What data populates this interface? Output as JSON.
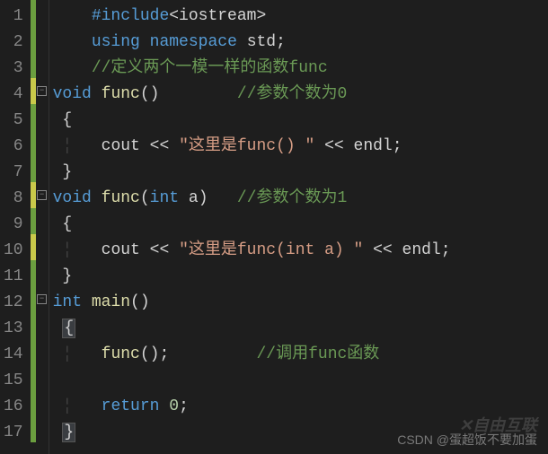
{
  "lines": [
    {
      "num": "1",
      "mod": "green",
      "fold": "",
      "tokens": [
        {
          "t": "    ",
          "c": "plain"
        },
        {
          "t": "#include",
          "c": "kw"
        },
        {
          "t": "<iostream>",
          "c": "angle-include"
        }
      ]
    },
    {
      "num": "2",
      "mod": "green",
      "fold": "",
      "tokens": [
        {
          "t": "    ",
          "c": "plain"
        },
        {
          "t": "using",
          "c": "kw"
        },
        {
          "t": " ",
          "c": "plain"
        },
        {
          "t": "namespace",
          "c": "kw"
        },
        {
          "t": " ",
          "c": "plain"
        },
        {
          "t": "std",
          "c": "plain"
        },
        {
          "t": ";",
          "c": "punct"
        }
      ]
    },
    {
      "num": "3",
      "mod": "green",
      "fold": "",
      "tokens": [
        {
          "t": "    ",
          "c": "plain"
        },
        {
          "t": "//定义两个一模一样的函数func",
          "c": "comment"
        }
      ]
    },
    {
      "num": "4",
      "mod": "yellow",
      "fold": "box",
      "tokens": [
        {
          "t": "void",
          "c": "type"
        },
        {
          "t": " ",
          "c": "plain"
        },
        {
          "t": "func",
          "c": "ident"
        },
        {
          "t": "()",
          "c": "punct"
        },
        {
          "t": "        ",
          "c": "plain"
        },
        {
          "t": "//参数个数为0",
          "c": "comment"
        }
      ]
    },
    {
      "num": "5",
      "mod": "green",
      "fold": "",
      "tokens": [
        {
          "t": " ",
          "c": "plain"
        },
        {
          "t": "{",
          "c": "punct"
        }
      ]
    },
    {
      "num": "6",
      "mod": "green",
      "fold": "",
      "tokens": [
        {
          "t": " ",
          "c": "plain"
        },
        {
          "t": "¦",
          "c": "guide"
        },
        {
          "t": "   ",
          "c": "plain"
        },
        {
          "t": "cout",
          "c": "plain"
        },
        {
          "t": " << ",
          "c": "op"
        },
        {
          "t": "\"这里是func() \"",
          "c": "string"
        },
        {
          "t": " << ",
          "c": "op"
        },
        {
          "t": "endl",
          "c": "plain"
        },
        {
          "t": ";",
          "c": "punct"
        }
      ]
    },
    {
      "num": "7",
      "mod": "green",
      "fold": "",
      "tokens": [
        {
          "t": " ",
          "c": "plain"
        },
        {
          "t": "}",
          "c": "punct"
        }
      ]
    },
    {
      "num": "8",
      "mod": "yellow",
      "fold": "box",
      "tokens": [
        {
          "t": "void",
          "c": "type"
        },
        {
          "t": " ",
          "c": "plain"
        },
        {
          "t": "func",
          "c": "ident"
        },
        {
          "t": "(",
          "c": "punct"
        },
        {
          "t": "int",
          "c": "type"
        },
        {
          "t": " a",
          "c": "plain"
        },
        {
          "t": ")",
          "c": "punct"
        },
        {
          "t": "   ",
          "c": "plain"
        },
        {
          "t": "//参数个数为1",
          "c": "comment"
        }
      ]
    },
    {
      "num": "9",
      "mod": "green",
      "fold": "",
      "tokens": [
        {
          "t": " ",
          "c": "plain"
        },
        {
          "t": "{",
          "c": "punct"
        }
      ]
    },
    {
      "num": "10",
      "mod": "yellow",
      "fold": "",
      "tokens": [
        {
          "t": " ",
          "c": "plain"
        },
        {
          "t": "¦",
          "c": "guide"
        },
        {
          "t": "   ",
          "c": "plain"
        },
        {
          "t": "cout",
          "c": "plain"
        },
        {
          "t": " << ",
          "c": "op"
        },
        {
          "t": "\"这里是func(int a) \"",
          "c": "string"
        },
        {
          "t": " << ",
          "c": "op"
        },
        {
          "t": "endl",
          "c": "plain"
        },
        {
          "t": ";",
          "c": "punct"
        }
      ]
    },
    {
      "num": "11",
      "mod": "green",
      "fold": "",
      "tokens": [
        {
          "t": " ",
          "c": "plain"
        },
        {
          "t": "}",
          "c": "punct"
        }
      ]
    },
    {
      "num": "12",
      "mod": "green",
      "fold": "box",
      "tokens": [
        {
          "t": "int",
          "c": "type"
        },
        {
          "t": " ",
          "c": "plain"
        },
        {
          "t": "main",
          "c": "ident"
        },
        {
          "t": "()",
          "c": "punct"
        }
      ]
    },
    {
      "num": "13",
      "mod": "green",
      "fold": "",
      "tokens": [
        {
          "t": " ",
          "c": "plain"
        },
        {
          "t": "{",
          "c": "punct brace-hl"
        }
      ]
    },
    {
      "num": "14",
      "mod": "green",
      "fold": "",
      "tokens": [
        {
          "t": " ",
          "c": "plain"
        },
        {
          "t": "¦",
          "c": "guide"
        },
        {
          "t": "   ",
          "c": "plain"
        },
        {
          "t": "func",
          "c": "ident"
        },
        {
          "t": "();",
          "c": "punct"
        },
        {
          "t": "         ",
          "c": "plain"
        },
        {
          "t": "//调用func函数",
          "c": "comment"
        }
      ]
    },
    {
      "num": "15",
      "mod": "green",
      "fold": "",
      "tokens": [
        {
          "t": "",
          "c": "plain"
        }
      ]
    },
    {
      "num": "16",
      "mod": "green",
      "fold": "",
      "tokens": [
        {
          "t": " ",
          "c": "plain"
        },
        {
          "t": "¦",
          "c": "guide"
        },
        {
          "t": "   ",
          "c": "plain"
        },
        {
          "t": "return",
          "c": "kw"
        },
        {
          "t": " ",
          "c": "plain"
        },
        {
          "t": "0",
          "c": "number"
        },
        {
          "t": ";",
          "c": "punct"
        }
      ]
    },
    {
      "num": "17",
      "mod": "green",
      "fold": "",
      "tokens": [
        {
          "t": " ",
          "c": "plain"
        },
        {
          "t": "}",
          "c": "punct brace-hl"
        }
      ]
    }
  ],
  "watermark_logo": "✕自由互联",
  "watermark": "CSDN @蛋超饭不要加蛋"
}
